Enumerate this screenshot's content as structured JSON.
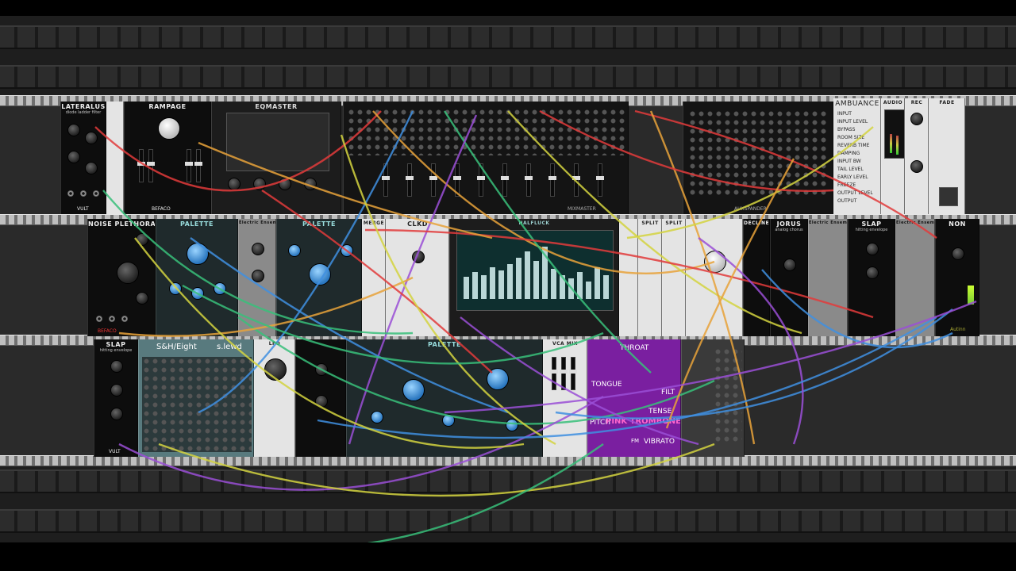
{
  "rack": {
    "row1": {
      "modules": [
        {
          "id": "lateralus",
          "title": "LATERALUS",
          "subtitle": "diode ladder filter",
          "brand": "VULT"
        },
        {
          "id": "rampage",
          "title": "RAMPAGE",
          "brand": "BEFACO"
        },
        {
          "id": "eqmaster",
          "title": "EQMASTER"
        },
        {
          "id": "mixmaster",
          "title": "MIXMASTER"
        },
        {
          "id": "auxspander",
          "title": "AUXSPANDER"
        },
        {
          "id": "ambuance",
          "title": "AMBUANCE",
          "params": [
            "INPUT",
            "INPUT LEVEL",
            "BYPASS",
            "ROOM SIZE",
            "REVERB TIME",
            "DAMPING",
            "INPUT BW",
            "TAIL LEVEL",
            "EARLY LEVEL",
            "FREEZE",
            "OUTPUT LEVEL",
            "OUTPUT"
          ]
        },
        {
          "id": "audio",
          "title": "AUDIO"
        },
        {
          "id": "rec",
          "title": "REC"
        },
        {
          "id": "fade",
          "title": "FADE"
        }
      ]
    },
    "row2": {
      "modules": [
        {
          "id": "noise-plethora",
          "title": "NOISE PLETHORA",
          "brand": "BEFACO"
        },
        {
          "id": "palette-1",
          "title": "PALETTE"
        },
        {
          "id": "electric-ensemble-1",
          "title": "Electric Ensemble"
        },
        {
          "id": "palette-2",
          "title": "PALETTE"
        },
        {
          "id": "merge",
          "title": "MERGE"
        },
        {
          "id": "clkd",
          "title": "CLKD"
        },
        {
          "id": "scope",
          "title": "HALFLUCK"
        },
        {
          "id": "split",
          "title": "SPLIT"
        },
        {
          "id": "split-2",
          "title": "SPLIT"
        },
        {
          "id": "decline",
          "title": "DECLINE"
        },
        {
          "id": "jorus",
          "title": "JORUS",
          "subtitle": "analog chorus"
        },
        {
          "id": "electric-ensemble-2",
          "title": "Electric Ensemble"
        },
        {
          "id": "slap-1",
          "title": "SLAP",
          "subtitle": "hitting envelope"
        },
        {
          "id": "electric-ensemble-3",
          "title": "Electric Ensemble"
        },
        {
          "id": "non",
          "title": "NON",
          "brand": "Autinn"
        }
      ]
    },
    "row3": {
      "modules": [
        {
          "id": "slap-2",
          "title": "SLAP",
          "subtitle": "hitting envelope",
          "brand": "VULT"
        },
        {
          "id": "sh-eight",
          "title": "S&H/Eight",
          "brand": "s.lewd"
        },
        {
          "id": "lfo",
          "title": "LFO"
        },
        {
          "id": "palette-3",
          "title": "PALETTE"
        },
        {
          "id": "vca-mix",
          "title": "VCA MIX"
        },
        {
          "id": "pink-trombone",
          "title": "PINK TROMBONE",
          "labels": [
            "THROAT",
            "TONGUE",
            "FILT",
            "TENSE",
            "VIBRATO",
            "PITCH",
            "FM"
          ]
        }
      ]
    }
  },
  "colors": {
    "background": "#1e1e1e",
    "rail": "#bfbfbf",
    "cable_colors": [
      "#e23b3b",
      "#e8a23a",
      "#3f8fe0",
      "#38c07a",
      "#9a4fd6",
      "#d4d440"
    ]
  }
}
